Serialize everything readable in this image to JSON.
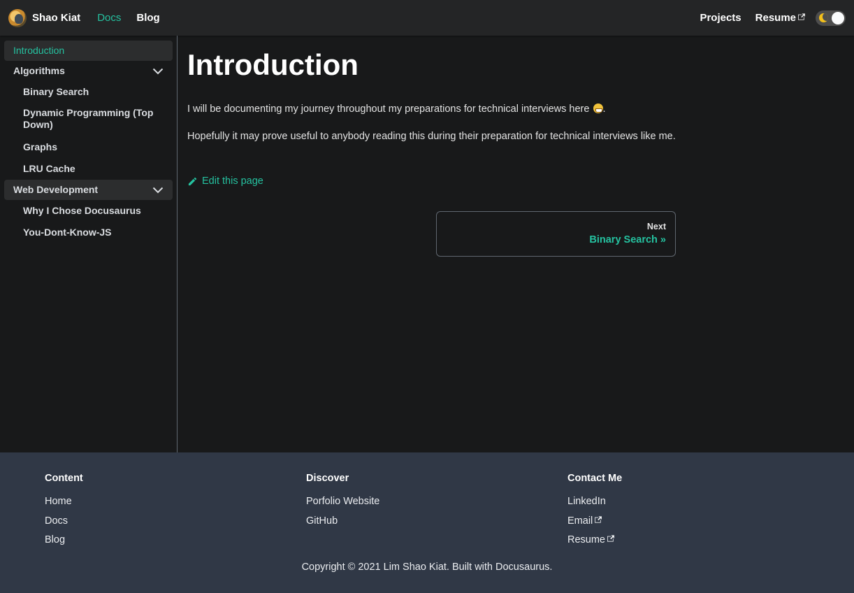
{
  "navbar": {
    "brand_title": "Shao Kiat",
    "links_left": [
      {
        "label": "Docs",
        "active": true
      },
      {
        "label": "Blog",
        "active": false
      }
    ],
    "links_right": [
      {
        "label": "Projects",
        "external": false
      },
      {
        "label": "Resume",
        "external": true
      }
    ],
    "theme_toggle": {
      "mode": "dark"
    }
  },
  "sidebar": {
    "items": [
      {
        "label": "Introduction",
        "active": true
      },
      {
        "label": "Algorithms",
        "type": "category",
        "expanded": true,
        "children": [
          "Binary Search",
          "Dynamic Programming (Top Down)",
          "Graphs",
          "LRU Cache"
        ]
      },
      {
        "label": "Web Development",
        "type": "category",
        "expanded": true,
        "children": [
          "Why I Chose Docusaurus",
          "You-Dont-Know-JS"
        ]
      }
    ]
  },
  "main": {
    "title": "Introduction",
    "paragraph1": "I will be documenting my journey throughout my preparations for technical interviews here",
    "paragraph1_end": ".",
    "paragraph2": "Hopefully it may prove useful to anybody reading this during their preparation for technical interviews like me.",
    "edit_link": "Edit this page",
    "pager": {
      "sublabel": "Next",
      "label": "Binary Search »"
    }
  },
  "footer": {
    "columns": [
      {
        "title": "Content",
        "links": [
          {
            "label": "Home"
          },
          {
            "label": "Docs"
          },
          {
            "label": "Blog"
          }
        ]
      },
      {
        "title": "Discover",
        "links": [
          {
            "label": "Porfolio Website"
          },
          {
            "label": "GitHub"
          }
        ]
      },
      {
        "title": "Contact Me",
        "links": [
          {
            "label": "LinkedIn"
          },
          {
            "label": "Email",
            "external": true
          },
          {
            "label": "Resume",
            "external": true
          }
        ]
      }
    ],
    "copyright": "Copyright © 2021 Lim Shao Kiat. Built with Docusaurus."
  },
  "colors": {
    "accent": "#25c2a0",
    "navbar_bg": "#242526",
    "page_bg": "#18191a",
    "footer_bg": "#303846"
  }
}
